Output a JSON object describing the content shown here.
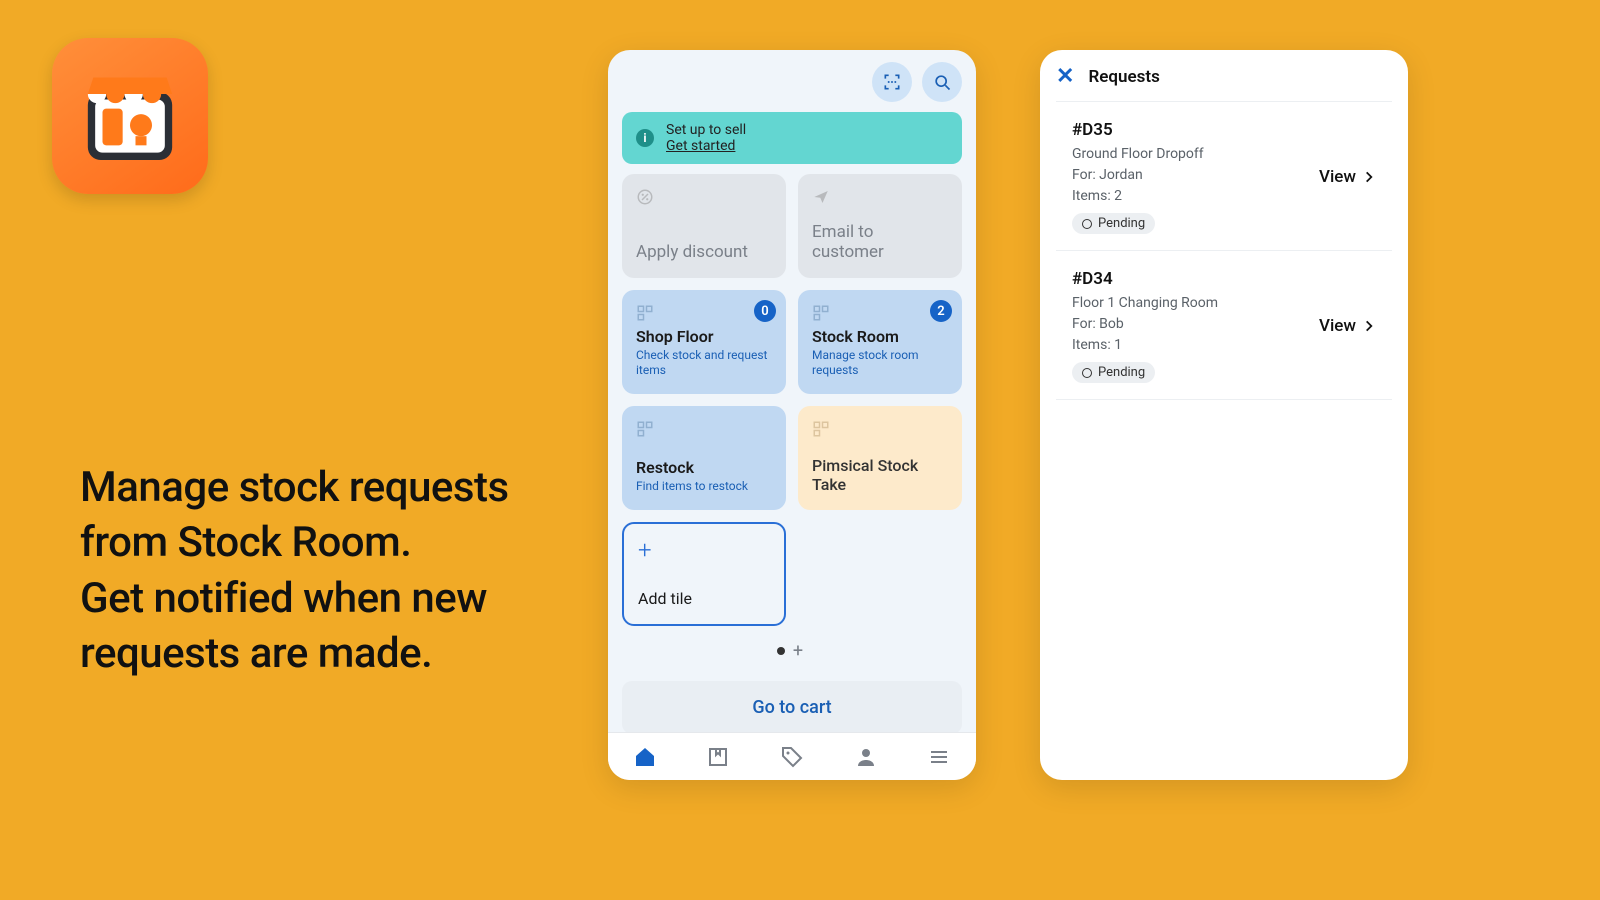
{
  "promo": {
    "line1": "Manage stock requests from Stock Room.",
    "line2": "Get notified when new requests are made."
  },
  "phone1": {
    "banner": {
      "title": "Set up to sell",
      "link": "Get started"
    },
    "tiles": {
      "discount": {
        "label": "Apply discount"
      },
      "email": {
        "label": "Email to customer"
      },
      "shopfloor": {
        "title": "Shop Floor",
        "sub": "Check stock and request items",
        "badge": "0"
      },
      "stockroom": {
        "title": "Stock Room",
        "sub": "Manage stock room requests",
        "badge": "2"
      },
      "restock": {
        "title": "Restock",
        "sub": "Find items to restock"
      },
      "pimsical": {
        "title": "Pimsical Stock Take"
      },
      "addtile": {
        "label": "Add tile"
      }
    },
    "gocart": "Go to cart"
  },
  "phone2": {
    "title": "Requests",
    "view_label": "View",
    "requests": [
      {
        "id": "#D35",
        "location": "Ground Floor Dropoff",
        "for": "For: Jordan",
        "items": "Items: 2",
        "status": "Pending"
      },
      {
        "id": "#D34",
        "location": "Floor 1 Changing Room",
        "for": "For: Bob",
        "items": "Items: 1",
        "status": "Pending"
      }
    ]
  }
}
